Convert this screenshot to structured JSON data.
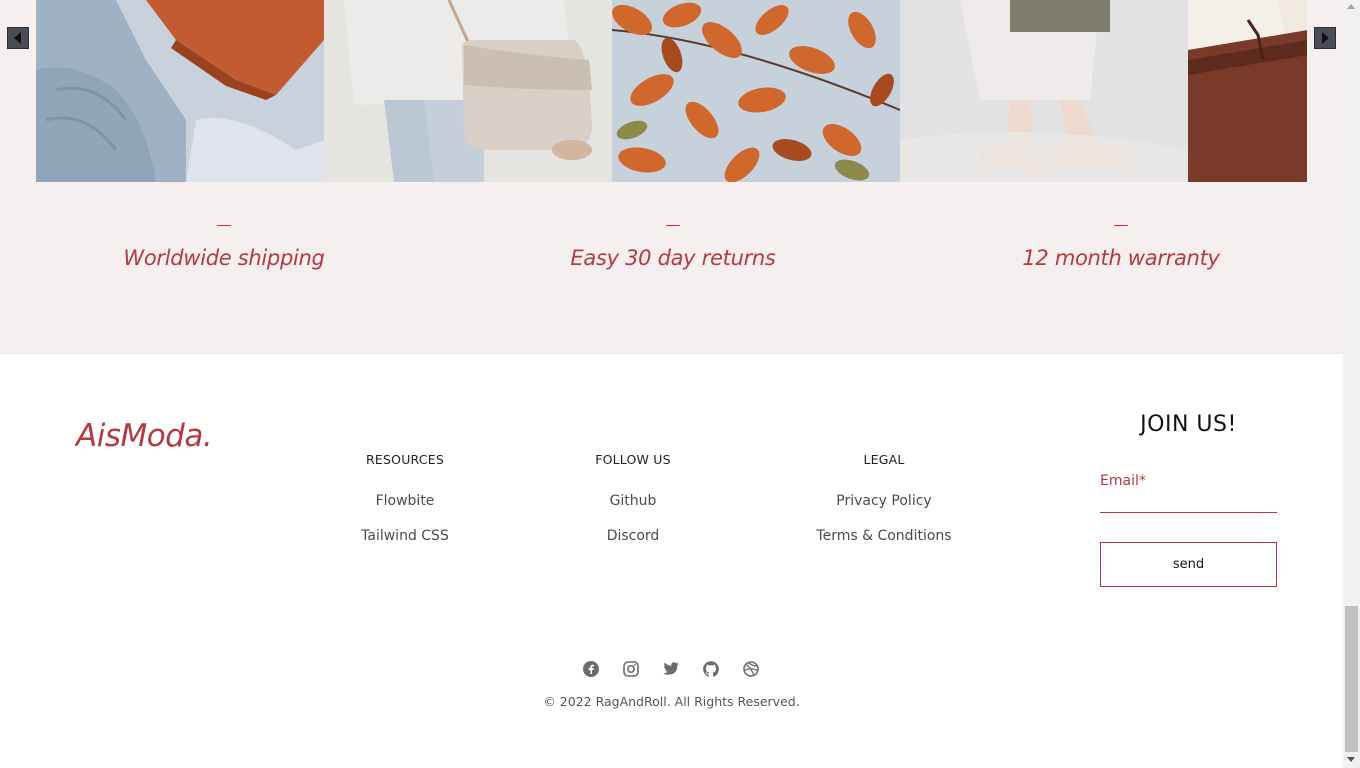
{
  "gallery": {
    "tiles": [
      "sweater-and-leather-bag",
      "woman-with-cream-shoulder-bag",
      "autumn-leaves-branch",
      "sandals-and-bag",
      "brown-leather-bag"
    ],
    "prev_icon": "caret-left-icon",
    "next_icon": "caret-right-icon"
  },
  "features": [
    {
      "label": "Worldwide shipping"
    },
    {
      "label": "Easy 30 day returns"
    },
    {
      "label": "12 month warranty"
    }
  ],
  "footer": {
    "logo": "AisModa.",
    "columns": [
      {
        "title": "RESOURCES",
        "links": [
          "Flowbite",
          "Tailwind CSS"
        ]
      },
      {
        "title": "FOLLOW US",
        "links": [
          "Github",
          "Discord"
        ]
      },
      {
        "title": "LEGAL",
        "links": [
          "Privacy Policy",
          "Terms & Conditions"
        ]
      }
    ],
    "newsletter": {
      "title": "JOIN US!",
      "email_label": "Email*",
      "email_value": "",
      "button_label": "send"
    },
    "social_icons": [
      "facebook-icon",
      "instagram-icon",
      "twitter-icon",
      "github-icon",
      "dribbble-icon"
    ],
    "copyright": "© 2022 RagAndRoll. All Rights Reserved."
  },
  "colors": {
    "accent": "#b8383f",
    "section_bg": "#f6efef",
    "arrow_bg": "#4a4d57"
  }
}
